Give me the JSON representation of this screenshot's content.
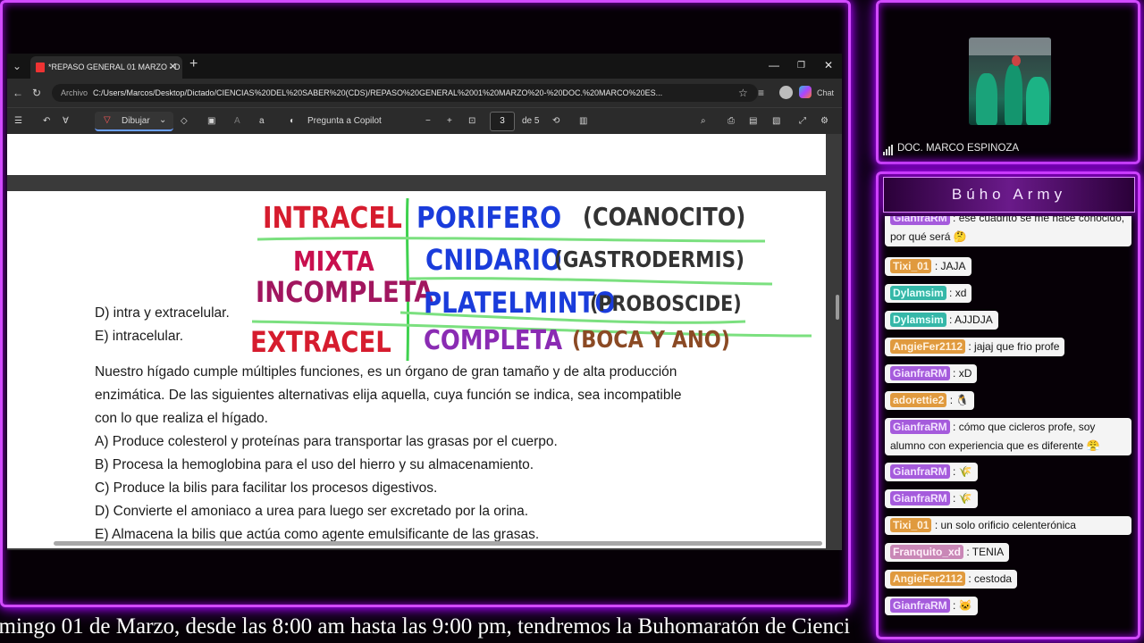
{
  "browser": {
    "tab_title": "*REPASO GENERAL 01 MARZO - D",
    "address_label": "Archivo",
    "url": "C:/Users/Marcos/Desktop/Dictado/CIENCIAS%20DEL%20SABER%20(CDS)/REPASO%20GENERAL%2001%20MARZO%20-%20DOC.%20MARCO%20ES...",
    "chat_label": "Chat"
  },
  "pdf_toolbar": {
    "draw_label": "Dibujar",
    "copilot_label": "Pregunta a Copilot",
    "page_current": "3",
    "page_total": "de 5"
  },
  "handwriting": {
    "rows": [
      {
        "left": "INTRACEL",
        "left_color": "#d61c2e",
        "right": "PORIFERO",
        "right_color": "#1a3cdb",
        "note": "(COANOCITO)",
        "note_color": "#333333"
      },
      {
        "left": "MIXTA",
        "left_color": "#c8104e",
        "right": "CNIDARIO",
        "right_color": "#1a3cdb",
        "note": "(GASTRODERMIS)",
        "note_color": "#333333"
      },
      {
        "left": "INCOMPLETA",
        "left_color": "#a1165f",
        "right": "PLATELMINTO",
        "right_color": "#1a3cdb",
        "note": "(PROBOSCIDE)",
        "note_color": "#333333"
      },
      {
        "left": "EXTRACEL",
        "left_color": "#d61c2e",
        "right": "COMPLETA",
        "right_color": "#8a2bb3",
        "note": "(BOCA Y ANO)",
        "note_color": "#8b4a24"
      }
    ]
  },
  "document": {
    "option_d_prev": "D) intra y extracelular.",
    "option_e_prev": "E) intracelular.",
    "question_lines": [
      "Nuestro hígado cumple múltiples funciones, es un órgano de gran tamaño y de alta producción",
      "enzimática. De las siguientes alternativas elija aquella, cuya función se indica, sea incompatible",
      "con lo que realiza el hígado."
    ],
    "options": [
      "A) Produce colesterol y proteínas para transportar las grasas por el cuerpo.",
      "B) Procesa la hemoglobina para el uso del hierro y su almacenamiento.",
      "C) Produce la bilis para facilitar los procesos digestivos.",
      "D) Convierte el amoniaco a urea para luego ser excretado por la orina.",
      "E) Almacena la bilis que actúa como agente emulsificante de las grasas."
    ]
  },
  "ticker": "omingo 01 de Marzo, desde las 8:00 am hasta las 9:00 pm, tendremos la Buhomaratón de Cienci",
  "camera": {
    "name": "DOC. MARCO ESPINOZA"
  },
  "chat": {
    "title": "Búho Army",
    "messages": [
      {
        "user": "GianfraRM",
        "color": "u-purple",
        "text": ": ese cuadrito se me hace conocido, por qué será",
        "emoji": "🤔"
      },
      {
        "user": "Tixi_01",
        "color": "u-orange",
        "text": ": JAJA",
        "emoji": ""
      },
      {
        "user": "Dylamsim",
        "color": "u-teal",
        "text": ": xd",
        "emoji": ""
      },
      {
        "user": "Dylamsim",
        "color": "u-teal",
        "text": ": AJJDJA",
        "emoji": ""
      },
      {
        "user": "AngieFer2112",
        "color": "u-orange",
        "text": ": jajaj que frio profe",
        "emoji": ""
      },
      {
        "user": "GianfraRM",
        "color": "u-purple",
        "text": ": xD",
        "emoji": ""
      },
      {
        "user": "adorettie2",
        "color": "u-orange",
        "text": ":",
        "emoji": "🐧"
      },
      {
        "user": "GianfraRM",
        "color": "u-purple",
        "text": ": cómo que cicleros profe, soy alumno con experiencia que es diferente",
        "emoji": "😤"
      },
      {
        "user": "GianfraRM",
        "color": "u-purple",
        "text": ":",
        "emoji": "🌾"
      },
      {
        "user": "GianfraRM",
        "color": "u-purple",
        "text": ":",
        "emoji": "🌾"
      },
      {
        "user": "Tixi_01",
        "color": "u-orange",
        "text": ": un solo orificio celenterónica",
        "emoji": ""
      },
      {
        "user": "Franquito_xd",
        "color": "u-pink",
        "text": ": TENIA",
        "emoji": ""
      },
      {
        "user": "AngieFer2112",
        "color": "u-orange",
        "text": ": cestoda",
        "emoji": ""
      },
      {
        "user": "GianfraRM",
        "color": "u-purple",
        "text": ":",
        "emoji": "🐱"
      }
    ]
  }
}
